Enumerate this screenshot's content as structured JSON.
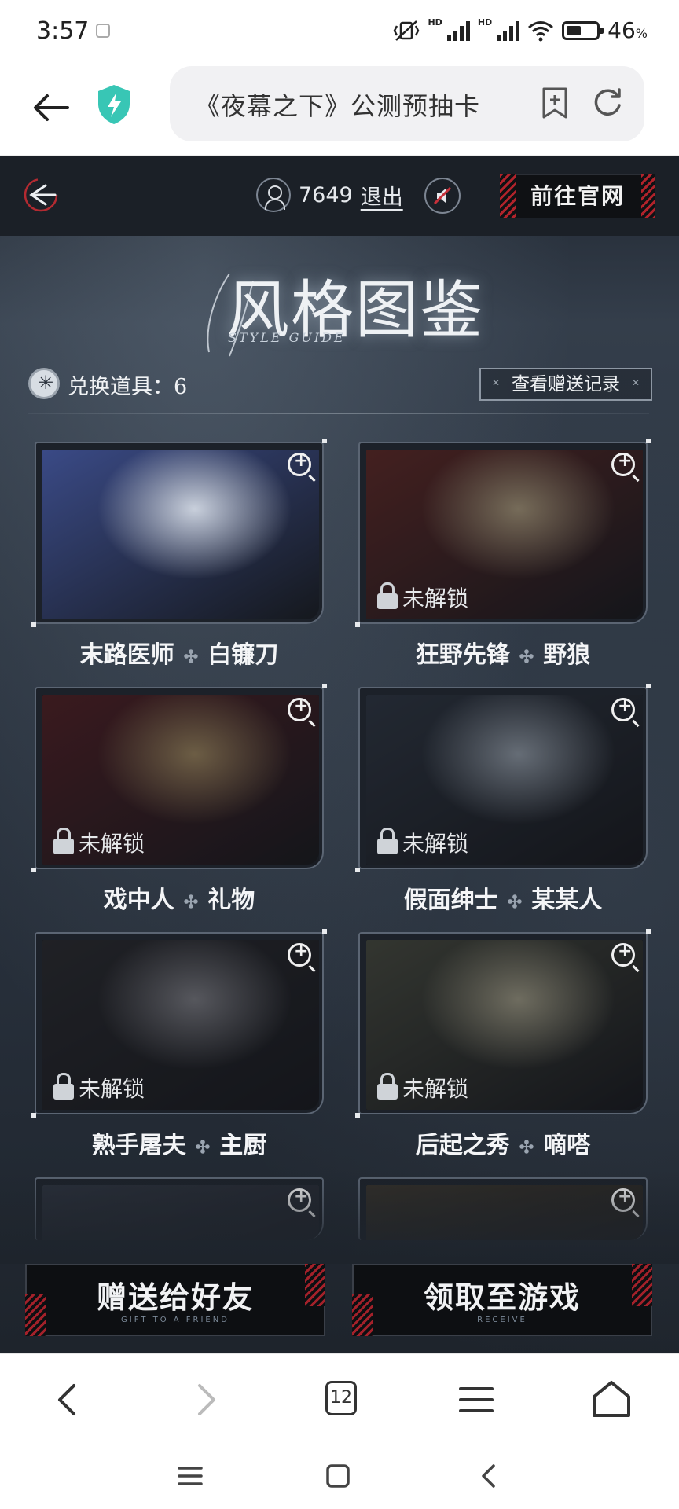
{
  "status_bar": {
    "time": "3:57",
    "network_hd_1": "HD",
    "network_hd_2": "HD",
    "battery_percent": "46",
    "battery_unit": "%"
  },
  "browser": {
    "url_title": "《夜幕之下》公测预抽卡",
    "tab_count": "12"
  },
  "header": {
    "user_id": "7649",
    "logout": "退出",
    "official_site": "前往官网"
  },
  "title": {
    "zh": "风格图鉴",
    "en": "STYLE GUIDE"
  },
  "exchange": {
    "label": "兑换道具：6",
    "gift_record": "查看赠送记录"
  },
  "cards": [
    {
      "role": "末路医师",
      "style": "白镰刀",
      "locked": false,
      "lock_label": "",
      "colors": [
        "#3a4a86",
        "#c9d0dc"
      ]
    },
    {
      "role": "狂野先锋",
      "style": "野狼",
      "locked": true,
      "lock_label": "未解锁",
      "colors": [
        "#6b2a26",
        "#c7b48f"
      ]
    },
    {
      "role": "戏中人",
      "style": "礼物",
      "locked": true,
      "lock_label": "未解锁",
      "colors": [
        "#5a1f24",
        "#b59a6a"
      ]
    },
    {
      "role": "假面绅士",
      "style": "某某人",
      "locked": true,
      "lock_label": "未解锁",
      "colors": [
        "#2f3a48",
        "#a9b6c3"
      ]
    },
    {
      "role": "熟手屠夫",
      "style": "主厨",
      "locked": true,
      "lock_label": "未解锁",
      "colors": [
        "#2a2c31",
        "#8d8f96"
      ]
    },
    {
      "role": "后起之秀",
      "style": "嘀嗒",
      "locked": true,
      "lock_label": "未解锁",
      "colors": [
        "#4d5244",
        "#b9b59a"
      ]
    }
  ],
  "actions": {
    "gift_zh": "赠送给好友",
    "gift_en": "GIFT TO A FRIEND",
    "receive_zh": "领取至游戏",
    "receive_en": "RECEIVE"
  },
  "icons": {
    "back": "arrow-left-icon",
    "security": "shield-bolt-icon",
    "bookmark": "add-bookmark-icon",
    "reload": "reload-icon",
    "logo": "site-logo-icon",
    "mute": "mute-icon",
    "zoom": "zoom-in-icon",
    "lock": "lock-icon"
  },
  "colors": {
    "accent_red": "#a3212a",
    "page_bg": "#2b3440",
    "security_teal": "#38c6b5"
  }
}
